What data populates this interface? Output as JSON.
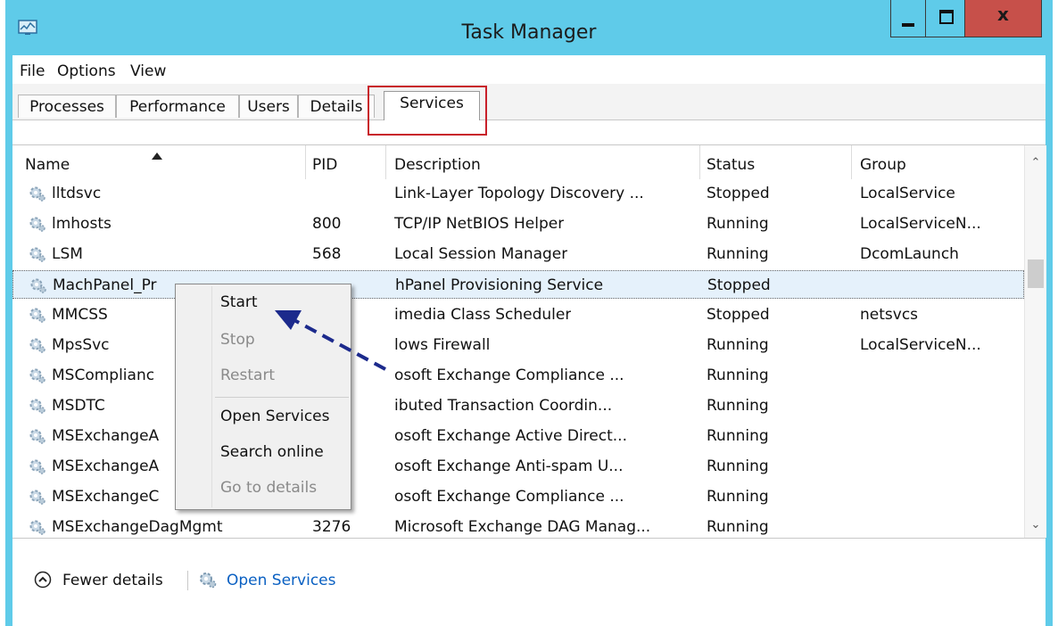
{
  "window": {
    "title": "Task Manager",
    "close_glyph": "x"
  },
  "menu": [
    "File",
    "Options",
    "View"
  ],
  "tabs": [
    "Processes",
    "Performance",
    "Users",
    "Details",
    "Services"
  ],
  "active_tab": "Services",
  "table": {
    "columns": [
      "Name",
      "PID",
      "Description",
      "Status",
      "Group"
    ],
    "sorted_column": "Name",
    "rows": [
      {
        "name": "lltdsvc",
        "pid": "",
        "description": "Link-Layer Topology Discovery ...",
        "status": "Stopped",
        "group": "LocalService"
      },
      {
        "name": "lmhosts",
        "pid": "800",
        "description": "TCP/IP NetBIOS Helper",
        "status": "Running",
        "group": "LocalServiceN..."
      },
      {
        "name": "LSM",
        "pid": "568",
        "description": "Local Session Manager",
        "status": "Running",
        "group": "DcomLaunch"
      },
      {
        "name": "MachPanel_Pr",
        "pid": "",
        "description": "hPanel Provisioning Service",
        "status": "Stopped",
        "group": ""
      },
      {
        "name": "MMCSS",
        "pid": "",
        "description": "imedia Class Scheduler",
        "status": "Stopped",
        "group": "netsvcs"
      },
      {
        "name": "MpsSvc",
        "pid": "",
        "description": "lows Firewall",
        "status": "Running",
        "group": "LocalServiceN..."
      },
      {
        "name": "MSComplianc",
        "pid": "",
        "description": "osoft Exchange Compliance ...",
        "status": "Running",
        "group": ""
      },
      {
        "name": "MSDTC",
        "pid": "",
        "description": "ibuted Transaction Coordin...",
        "status": "Running",
        "group": ""
      },
      {
        "name": "MSExchangeA",
        "pid": "",
        "description": "osoft Exchange Active Direct...",
        "status": "Running",
        "group": ""
      },
      {
        "name": "MSExchangeA",
        "pid": "",
        "description": "osoft Exchange Anti-spam U...",
        "status": "Running",
        "group": ""
      },
      {
        "name": "MSExchangeC",
        "pid": "",
        "description": "osoft Exchange Compliance ...",
        "status": "Running",
        "group": ""
      },
      {
        "name": "MSExchangeDagMgmt",
        "pid": "3276",
        "description": "Microsoft Exchange DAG Manag...",
        "status": "Running",
        "group": ""
      }
    ],
    "selected_row_index": 3
  },
  "context_menu": {
    "items": [
      {
        "label": "Start",
        "enabled": true
      },
      {
        "label": "Stop",
        "enabled": false
      },
      {
        "label": "Restart",
        "enabled": false
      },
      {
        "label": "Open Services",
        "enabled": true
      },
      {
        "label": "Search online",
        "enabled": true
      },
      {
        "label": "Go to details",
        "enabled": false
      }
    ]
  },
  "footer": {
    "fewer_details": "Fewer details",
    "open_services": "Open Services"
  },
  "colors": {
    "title_bar": "#5fcbe9",
    "close_button": "#c7504a",
    "highlight_box": "#c8202a",
    "arrow": "#1c2a8c",
    "link": "#0a60c2",
    "selection": "#e5f1fb"
  },
  "icons": [
    "task-manager-icon",
    "gear-icon",
    "sort-up-icon",
    "chevron-up-icon",
    "chevron-down-icon",
    "fewer-details-icon",
    "arrow-annotation"
  ]
}
